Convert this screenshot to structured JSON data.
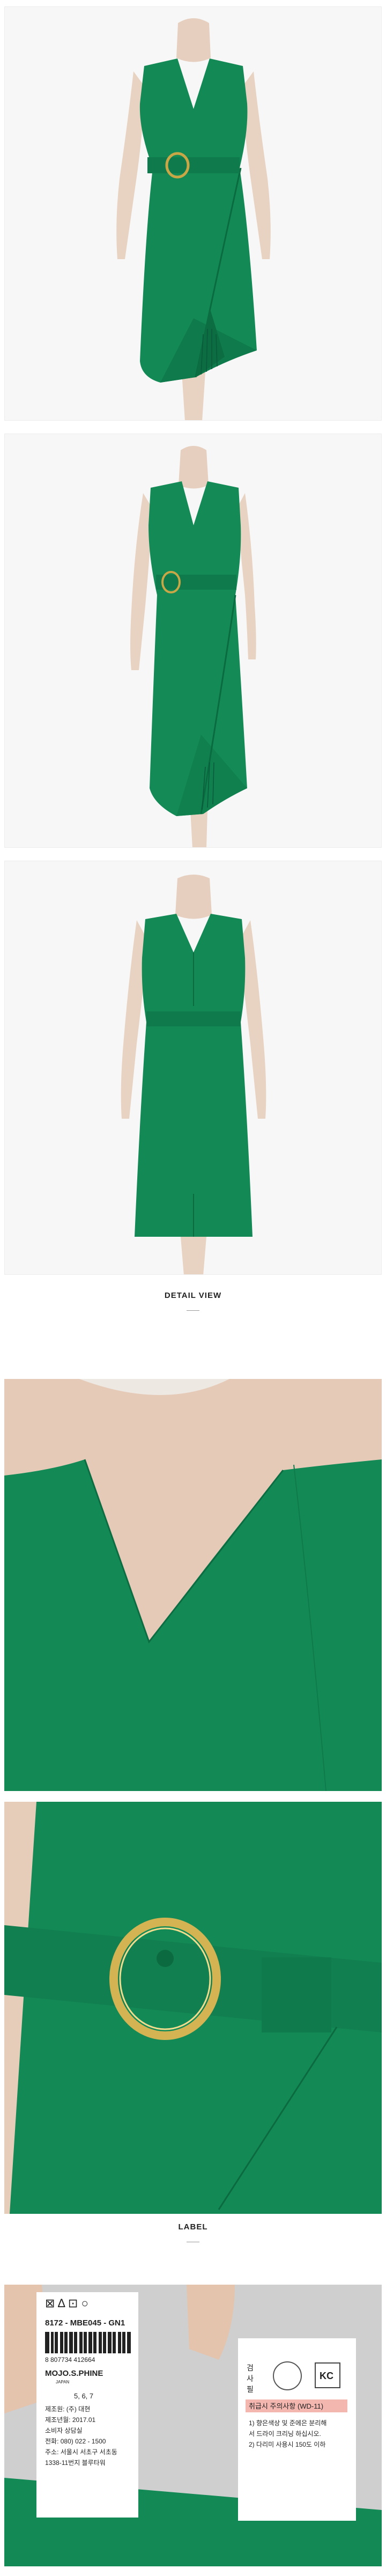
{
  "colors": {
    "dress_green": "#138a56",
    "dress_green_dark": "#0b6e42",
    "skin": "#e9d3c2",
    "background": "#f7f7f7"
  },
  "detail_section": {
    "heading": "DETAIL VIEW"
  },
  "label_section": {
    "heading": "LABEL"
  },
  "care_tag": {
    "barcode_digits": "8 807734 412664",
    "style_code": "8172 - MBE045 - GN1",
    "sizes": "5, 6, 7",
    "maker": "제조원: (주) 대현",
    "made_date": "제조년월: 2017.01",
    "service": "소비자 상담실",
    "phone": "전화: 080) 022 - 1500",
    "address": "주소: 서울시 서초구 서초동",
    "address2": "1338-11번지 블루타워",
    "brand": "MOJO.S.PHINE",
    "brand_sub": "JAPAN"
  },
  "inspection_tag": {
    "vertical_label": "검사필",
    "caution": "취급시 주의사항 (WD-11)",
    "line1": "1) 향은색상 및 준에은 분리해",
    "line2": "서 드라이 크리닝 하십시오.",
    "line3": "2) 다리미 사용시 150도 이하",
    "kc": "KC"
  }
}
